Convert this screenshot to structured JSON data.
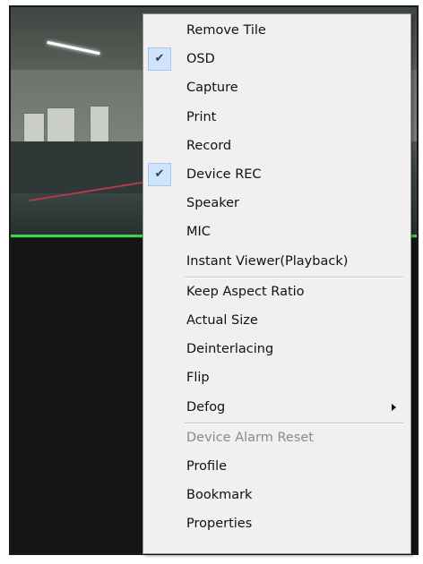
{
  "colors": {
    "menu_background": "#f0f0f0",
    "check_highlight": "#cfe3fb",
    "tile_selected_border": "#35d84c",
    "disabled_text": "#8a8a8a"
  },
  "menu": {
    "items": [
      {
        "label": "Remove Tile",
        "checked": false,
        "disabled": false
      },
      {
        "label": "OSD",
        "checked": true,
        "disabled": false
      },
      {
        "label": "Capture",
        "checked": false,
        "disabled": false
      },
      {
        "label": "Print",
        "checked": false,
        "disabled": false
      },
      {
        "label": "Record",
        "checked": false,
        "disabled": false
      },
      {
        "label": "Device REC",
        "checked": true,
        "disabled": false
      },
      {
        "label": "Speaker",
        "checked": false,
        "disabled": false
      },
      {
        "label": "MIC",
        "checked": false,
        "disabled": false
      },
      {
        "label": "Instant Viewer(Playback)",
        "checked": false,
        "disabled": false
      },
      {
        "label": "Keep Aspect Ratio",
        "checked": false,
        "disabled": false
      },
      {
        "label": "Actual Size",
        "checked": false,
        "disabled": false
      },
      {
        "label": "Deinterlacing",
        "checked": false,
        "disabled": false
      },
      {
        "label": "Flip",
        "checked": false,
        "disabled": false
      },
      {
        "label": "Defog",
        "checked": false,
        "disabled": false,
        "submenu": true
      },
      {
        "label": "Device Alarm Reset",
        "checked": false,
        "disabled": true
      },
      {
        "label": "Profile",
        "checked": false,
        "disabled": false
      },
      {
        "label": "Bookmark",
        "checked": false,
        "disabled": false
      },
      {
        "label": "Properties",
        "checked": false,
        "disabled": false
      }
    ],
    "check_glyph": "✔",
    "icons": {
      "check": "checkmark-icon",
      "submenu": "submenu-arrow-icon"
    }
  }
}
